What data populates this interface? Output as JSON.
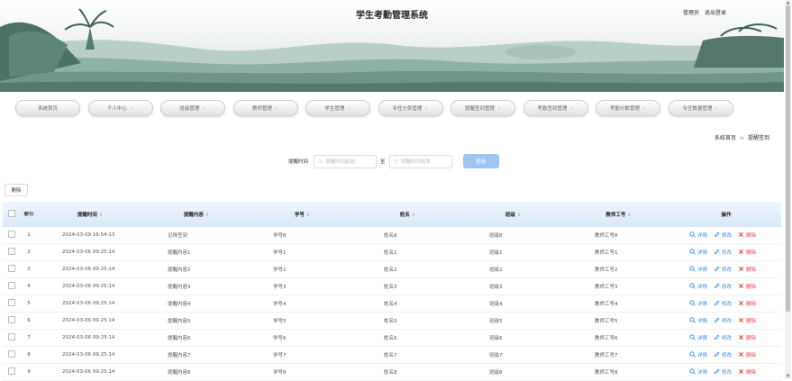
{
  "header": {
    "title": "学生考勤管理系统",
    "user": "管理员",
    "logout": "退出登录"
  },
  "nav": [
    {
      "label": "系统首页",
      "has_menu": false
    },
    {
      "label": "个人中心",
      "has_menu": true
    },
    {
      "label": "班级管理",
      "has_menu": true
    },
    {
      "label": "教师管理",
      "has_menu": true
    },
    {
      "label": "学生管理",
      "has_menu": true
    },
    {
      "label": "专任分类管理",
      "has_menu": true
    },
    {
      "label": "提醒签到管理",
      "has_menu": true
    },
    {
      "label": "考勤签到管理",
      "has_menu": true
    },
    {
      "label": "考勤分数管理",
      "has_menu": true
    },
    {
      "label": "专任数据管理",
      "has_menu": true
    }
  ],
  "breadcrumb": {
    "home": "系统首页",
    "sep": ">",
    "current": "提醒签到"
  },
  "search": {
    "label": "提醒时间",
    "start_placeholder": "提醒时间起始",
    "to": "至",
    "end_placeholder": "提醒时间结束",
    "query": "查询"
  },
  "toolbar": {
    "delete": "删除"
  },
  "table": {
    "headers": {
      "index": "索引",
      "time": "提醒时间",
      "content": "提醒内容",
      "student_no": "学号",
      "name": "姓名",
      "class": "班级",
      "teacher_no": "教师工号",
      "actions": "操作"
    },
    "actions": {
      "detail": "详情",
      "edit": "修改",
      "delete": "删除"
    },
    "rows": [
      {
        "idx": "1",
        "time": "2024-03-09 16:54:13",
        "content": "记得签到",
        "student_no": "学号8",
        "name": "姓名8",
        "class": "班级8",
        "teacher_no": "教师工号8"
      },
      {
        "idx": "2",
        "time": "2024-03-06 09:25:14",
        "content": "提醒内容1",
        "student_no": "学号1",
        "name": "姓名1",
        "class": "班级1",
        "teacher_no": "教师工号1"
      },
      {
        "idx": "3",
        "time": "2024-03-06 09:25:14",
        "content": "提醒内容2",
        "student_no": "学号2",
        "name": "姓名2",
        "class": "班级2",
        "teacher_no": "教师工号2"
      },
      {
        "idx": "4",
        "time": "2024-03-06 09:25:14",
        "content": "提醒内容3",
        "student_no": "学号3",
        "name": "姓名3",
        "class": "班级3",
        "teacher_no": "教师工号3"
      },
      {
        "idx": "5",
        "time": "2024-03-06 09:25:14",
        "content": "提醒内容4",
        "student_no": "学号4",
        "name": "姓名4",
        "class": "班级4",
        "teacher_no": "教师工号4"
      },
      {
        "idx": "6",
        "time": "2024-03-06 09:25:14",
        "content": "提醒内容5",
        "student_no": "学号5",
        "name": "姓名5",
        "class": "班级5",
        "teacher_no": "教师工号5"
      },
      {
        "idx": "7",
        "time": "2024-03-06 09:25:14",
        "content": "提醒内容6",
        "student_no": "学号6",
        "name": "姓名6",
        "class": "班级6",
        "teacher_no": "教师工号6"
      },
      {
        "idx": "8",
        "time": "2024-03-06 09:25:14",
        "content": "提醒内容7",
        "student_no": "学号7",
        "name": "姓名7",
        "class": "班级7",
        "teacher_no": "教师工号7"
      },
      {
        "idx": "9",
        "time": "2024-03-06 09:25:14",
        "content": "提醒内容8",
        "student_no": "学号8",
        "name": "姓名8",
        "class": "班级8",
        "teacher_no": "教师工号8"
      }
    ]
  },
  "colors": {
    "accent": "#3a8ee6",
    "danger": "#e04545",
    "query_button": "#9fc6f3",
    "table_header": "#d9e8f8"
  }
}
